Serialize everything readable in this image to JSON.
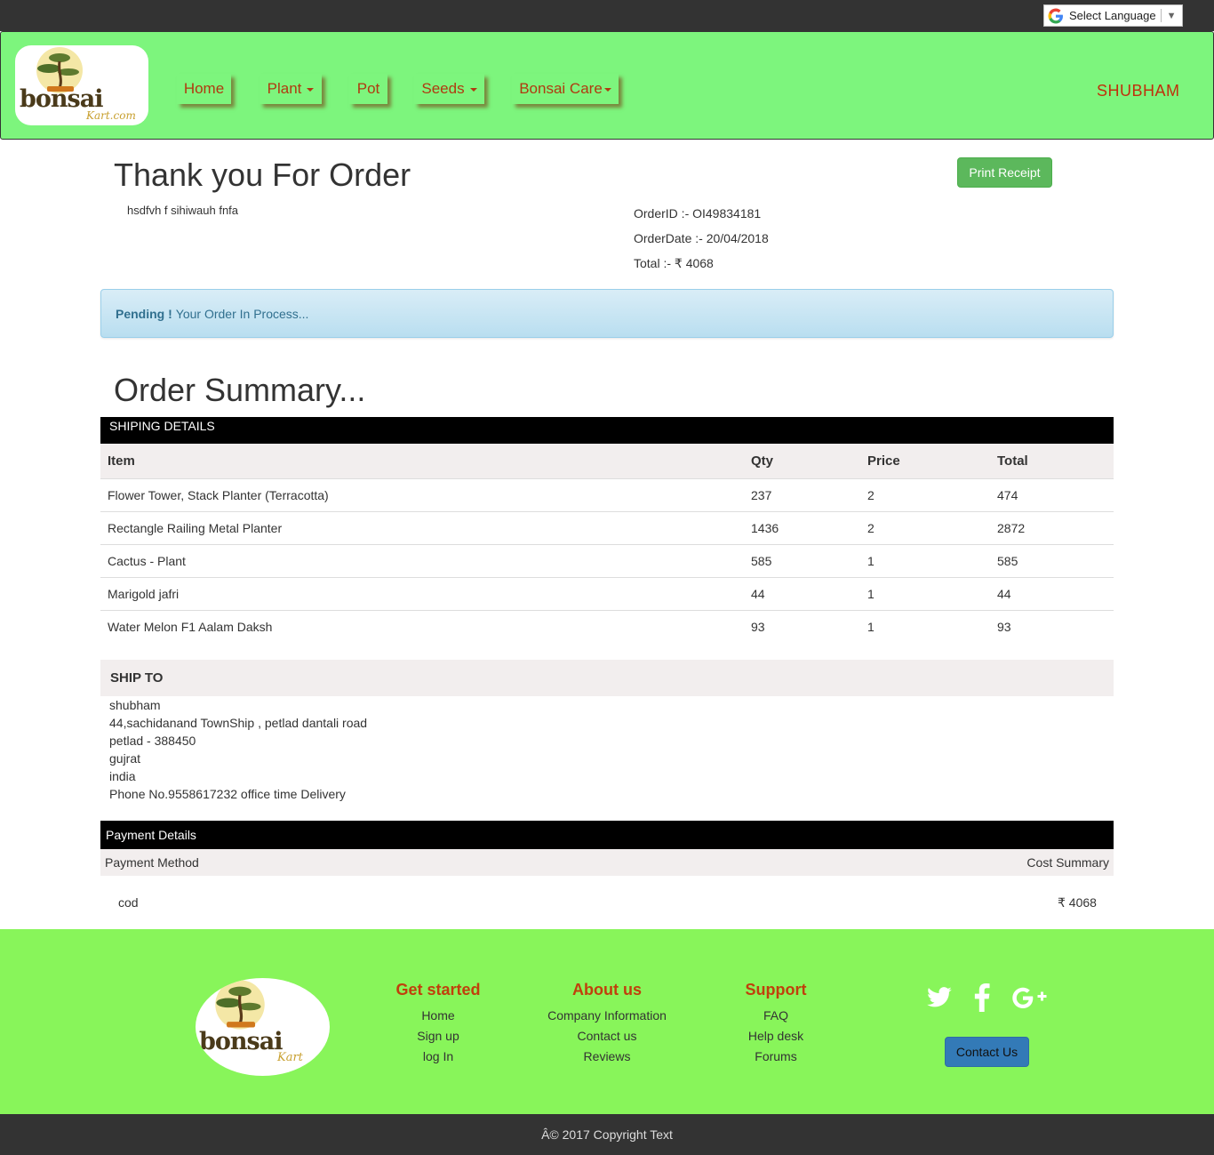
{
  "header": {
    "language_label": "Select Language",
    "logo_text": "bonsai",
    "logo_sub": "Kart.com",
    "nav": [
      {
        "label": "Home"
      },
      {
        "label": "Plant"
      },
      {
        "label": "Pot"
      },
      {
        "label": "Seeds"
      },
      {
        "label": "Bonsai Care"
      }
    ],
    "user": "SHUBHAM"
  },
  "order": {
    "title": "Thank you For Order",
    "print_label": "Print Receipt",
    "note": "hsdfvh f sihiwauh fnfa",
    "order_id": "OrderID :- OI49834181",
    "order_date": "OrderDate :- 20/04/2018",
    "total": "Total :- ₹ 4068",
    "status_strong": "Pending !",
    "status_text": "Your Order In Process..."
  },
  "summary": {
    "title": "Order Summary...",
    "shipping_bar": "SHIPING DETAILS",
    "columns": [
      "Item",
      "Qty",
      "Price",
      "Total"
    ],
    "rows": [
      [
        "Flower Tower, Stack Planter (Terracotta)",
        "237",
        "2",
        "474"
      ],
      [
        "Rectangle Railing Metal Planter",
        "1436",
        "2",
        "2872"
      ],
      [
        "Cactus - Plant",
        "585",
        "1",
        "585"
      ],
      [
        "Marigold jafri",
        "44",
        "1",
        "44"
      ],
      [
        "Water Melon F1 Aalam Daksh",
        "93",
        "1",
        "93"
      ]
    ]
  },
  "ship_to": {
    "heading": "SHIP TO",
    "lines": [
      "shubham",
      "44,sachidanand TownShip , petlad dantali road",
      "petlad - 388450",
      "gujrat",
      "india",
      "Phone No.9558617232 office time Delivery"
    ]
  },
  "payment": {
    "bar": "Payment Details",
    "method_label": "Payment Method",
    "cost_label": "Cost Summary",
    "method": "cod",
    "cost": "₹ 4068"
  },
  "footer": {
    "logo_text": "bonsai",
    "logo_sub": "Kart",
    "columns": [
      {
        "title": "Get started",
        "links": [
          "Home",
          "Sign up",
          "log In"
        ]
      },
      {
        "title": "About us",
        "links": [
          "Company Information",
          "Contact us",
          "Reviews"
        ]
      },
      {
        "title": "Support",
        "links": [
          "FAQ",
          "Help desk",
          "Forums"
        ]
      }
    ],
    "social_icons": [
      "twitter-icon",
      "facebook-icon",
      "google-plus-icon"
    ],
    "contact_label": "Contact Us",
    "copyright": "Â© 2017 Copyright Text"
  },
  "colors": {
    "navbar": "#7df57d",
    "footer": "#88f55a",
    "nav_text": "#b03a10",
    "print_button": "#5cb85c",
    "contact_button": "#337ab7"
  }
}
